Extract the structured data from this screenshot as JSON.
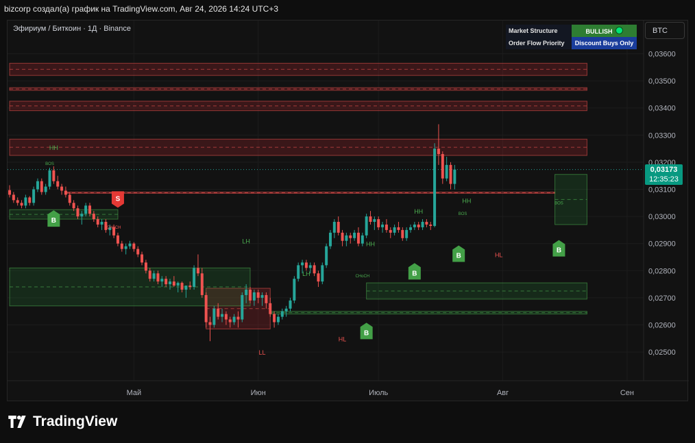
{
  "caption": "bizcorp создал(а) график на TradingView.com, Авг 24, 2026 14:24 UTC+3",
  "symbol_line": "Эфириум / Биткоин · 1Д · Binance",
  "info_table": {
    "market_structure_label": "Market Structure",
    "market_structure_value": "BULLISH",
    "order_flow_label": "Order Flow Priority",
    "order_flow_value": "Discount Buys Only"
  },
  "btc_button": "BTC",
  "last_price": "0,03173",
  "countdown": "12:35:23",
  "brand": "TradingView",
  "colors": {
    "up": "#26a69a",
    "down": "#ef5350",
    "background": "#121212",
    "bullish": "#2e7d32",
    "discount": "#1a3d9c",
    "price_tag": "#089981"
  },
  "chart_data": {
    "type": "candlestick",
    "ylim": [
      0.024,
      0.037
    ],
    "y_ticks": [
      "0,03600",
      "0,03500",
      "0,03400",
      "0,03300",
      "0,03200",
      "0,03100",
      "0,03000",
      "0,02900",
      "0,02800",
      "0,02700",
      "0,02600",
      "0,02500"
    ],
    "x_ticks": [
      "Май",
      "Июн",
      "Июль",
      "Авг",
      "Сен"
    ],
    "x_tick_days": [
      31,
      62,
      92,
      123,
      154
    ],
    "candles": [
      [
        0.03097,
        0.03115,
        0.0307,
        0.0308
      ],
      [
        0.0308,
        0.0309,
        0.0305,
        0.0306
      ],
      [
        0.0306,
        0.0307,
        0.0304,
        0.0305
      ],
      [
        0.0305,
        0.0306,
        0.0303,
        0.0304
      ],
      [
        0.0304,
        0.0308,
        0.0303,
        0.0307
      ],
      [
        0.0307,
        0.03075,
        0.0304,
        0.0305
      ],
      [
        0.0305,
        0.0311,
        0.0304,
        0.031
      ],
      [
        0.031,
        0.0314,
        0.0309,
        0.0313
      ],
      [
        0.0313,
        0.0314,
        0.0308,
        0.0309
      ],
      [
        0.0309,
        0.0312,
        0.0308,
        0.0311
      ],
      [
        0.0311,
        0.0318,
        0.031,
        0.0317
      ],
      [
        0.0317,
        0.03185,
        0.0312,
        0.0313
      ],
      [
        0.0313,
        0.0315,
        0.031,
        0.0311
      ],
      [
        0.0311,
        0.0312,
        0.0308,
        0.03095
      ],
      [
        0.03095,
        0.0311,
        0.0307,
        0.0308
      ],
      [
        0.0308,
        0.0309,
        0.0304,
        0.0305
      ],
      [
        0.0305,
        0.0306,
        0.0302,
        0.0303
      ],
      [
        0.0303,
        0.0304,
        0.0299,
        0.03
      ],
      [
        0.03,
        0.0302,
        0.0297,
        0.0301
      ],
      [
        0.0301,
        0.0305,
        0.03,
        0.0304
      ],
      [
        0.0304,
        0.0305,
        0.03,
        0.0301
      ],
      [
        0.0301,
        0.0302,
        0.0298,
        0.0299
      ],
      [
        0.0299,
        0.03,
        0.0296,
        0.0297
      ],
      [
        0.0297,
        0.0299,
        0.0295,
        0.0298
      ],
      [
        0.0298,
        0.0299,
        0.0294,
        0.0295
      ],
      [
        0.0295,
        0.0297,
        0.0293,
        0.0296
      ],
      [
        0.0296,
        0.0297,
        0.0292,
        0.0293
      ],
      [
        0.0293,
        0.0294,
        0.0289,
        0.029
      ],
      [
        0.029,
        0.0291,
        0.0287,
        0.0288
      ],
      [
        0.0288,
        0.029,
        0.0286,
        0.0289
      ],
      [
        0.0289,
        0.0291,
        0.0288,
        0.029
      ],
      [
        0.029,
        0.02905,
        0.0287,
        0.0288
      ],
      [
        0.0288,
        0.0289,
        0.0285,
        0.0286
      ],
      [
        0.0286,
        0.0287,
        0.0282,
        0.0283
      ],
      [
        0.0283,
        0.0284,
        0.0279,
        0.028
      ],
      [
        0.028,
        0.0281,
        0.0276,
        0.0277
      ],
      [
        0.0277,
        0.028,
        0.0276,
        0.0279
      ],
      [
        0.0279,
        0.028,
        0.0275,
        0.0276
      ],
      [
        0.0276,
        0.0278,
        0.0274,
        0.0277
      ],
      [
        0.0277,
        0.0278,
        0.0274,
        0.0275
      ],
      [
        0.0275,
        0.0277,
        0.0273,
        0.0276
      ],
      [
        0.0276,
        0.0278,
        0.0274,
        0.02745
      ],
      [
        0.02745,
        0.0276,
        0.0272,
        0.02755
      ],
      [
        0.02755,
        0.0276,
        0.0272,
        0.0273
      ],
      [
        0.0273,
        0.0274,
        0.027,
        0.02745
      ],
      [
        0.02745,
        0.0276,
        0.0273,
        0.0274
      ],
      [
        0.0274,
        0.0282,
        0.0273,
        0.0281
      ],
      [
        0.0281,
        0.0286,
        0.0278,
        0.0279
      ],
      [
        0.0279,
        0.0281,
        0.027,
        0.0271
      ],
      [
        0.0271,
        0.0272,
        0.0259,
        0.0261
      ],
      [
        0.0261,
        0.0263,
        0.0254,
        0.026
      ],
      [
        0.026,
        0.0267,
        0.0259,
        0.0266
      ],
      [
        0.0266,
        0.0268,
        0.0262,
        0.0263
      ],
      [
        0.0263,
        0.0266,
        0.0261,
        0.0264
      ],
      [
        0.0264,
        0.0265,
        0.026,
        0.0262
      ],
      [
        0.0262,
        0.0263,
        0.0259,
        0.0261
      ],
      [
        0.0261,
        0.0264,
        0.026,
        0.0263
      ],
      [
        0.0263,
        0.0265,
        0.0259,
        0.0262
      ],
      [
        0.0262,
        0.0272,
        0.0261,
        0.0271
      ],
      [
        0.0271,
        0.0275,
        0.0268,
        0.0273
      ],
      [
        0.0273,
        0.0274,
        0.0268,
        0.0269
      ],
      [
        0.0269,
        0.0273,
        0.0267,
        0.0272
      ],
      [
        0.0272,
        0.0273,
        0.0268,
        0.027
      ],
      [
        0.027,
        0.0272,
        0.0267,
        0.0271
      ],
      [
        0.0271,
        0.0272,
        0.0266,
        0.0268
      ],
      [
        0.0268,
        0.027,
        0.0263,
        0.0264
      ],
      [
        0.0264,
        0.0265,
        0.0259,
        0.0261
      ],
      [
        0.0261,
        0.0264,
        0.026,
        0.0263
      ],
      [
        0.0263,
        0.0266,
        0.0262,
        0.0265
      ],
      [
        0.0265,
        0.0267,
        0.0263,
        0.0266
      ],
      [
        0.0266,
        0.027,
        0.0265,
        0.0269
      ],
      [
        0.0269,
        0.0278,
        0.0268,
        0.0277
      ],
      [
        0.0277,
        0.0283,
        0.0276,
        0.0282
      ],
      [
        0.0282,
        0.0284,
        0.0279,
        0.0283
      ],
      [
        0.0283,
        0.0284,
        0.028,
        0.0281
      ],
      [
        0.0281,
        0.0283,
        0.0279,
        0.0282
      ],
      [
        0.0282,
        0.0283,
        0.0278,
        0.0279
      ],
      [
        0.0279,
        0.028,
        0.0274,
        0.0276
      ],
      [
        0.0276,
        0.0283,
        0.0275,
        0.0282
      ],
      [
        0.0282,
        0.029,
        0.0281,
        0.0289
      ],
      [
        0.0289,
        0.0295,
        0.0288,
        0.0294
      ],
      [
        0.0294,
        0.0299,
        0.0292,
        0.0298
      ],
      [
        0.0298,
        0.03,
        0.0293,
        0.0294
      ],
      [
        0.0294,
        0.0295,
        0.0289,
        0.0291
      ],
      [
        0.0291,
        0.0294,
        0.0289,
        0.0293
      ],
      [
        0.0293,
        0.0294,
        0.029,
        0.0292
      ],
      [
        0.0292,
        0.0295,
        0.0291,
        0.0294
      ],
      [
        0.0294,
        0.0296,
        0.0289,
        0.029
      ],
      [
        0.029,
        0.0294,
        0.0289,
        0.0293
      ],
      [
        0.0293,
        0.0301,
        0.0292,
        0.03
      ],
      [
        0.03,
        0.0302,
        0.0297,
        0.0298
      ],
      [
        0.0298,
        0.03,
        0.0295,
        0.0299
      ],
      [
        0.0299,
        0.03,
        0.0295,
        0.0296
      ],
      [
        0.0296,
        0.0298,
        0.0294,
        0.0297
      ],
      [
        0.0297,
        0.0299,
        0.0294,
        0.0295
      ],
      [
        0.0295,
        0.0296,
        0.0292,
        0.0294
      ],
      [
        0.0294,
        0.0297,
        0.0293,
        0.0296
      ],
      [
        0.0296,
        0.0298,
        0.0294,
        0.0295
      ],
      [
        0.0295,
        0.0296,
        0.0291,
        0.0292
      ],
      [
        0.0292,
        0.0296,
        0.0291,
        0.0295
      ],
      [
        0.0295,
        0.0297,
        0.0294,
        0.0296
      ],
      [
        0.0296,
        0.0298,
        0.0295,
        0.0297
      ],
      [
        0.0297,
        0.0298,
        0.0295,
        0.0296
      ],
      [
        0.0296,
        0.0299,
        0.0295,
        0.0298
      ],
      [
        0.0298,
        0.0299,
        0.0296,
        0.0297
      ],
      [
        0.0297,
        0.0298,
        0.0295,
        0.02965
      ],
      [
        0.02965,
        0.0327,
        0.0296,
        0.0325
      ],
      [
        0.0325,
        0.0334,
        0.0319,
        0.0323
      ],
      [
        0.0323,
        0.0324,
        0.0312,
        0.0314
      ],
      [
        0.0314,
        0.0322,
        0.0313,
        0.0319
      ],
      [
        0.0319,
        0.032,
        0.031,
        0.0312
      ],
      [
        0.0312,
        0.0319,
        0.031,
        0.03173
      ]
    ],
    "zones": [
      {
        "kind": "supply",
        "y1": 0.03565,
        "y2": 0.0352,
        "d1": 0,
        "d2": 144
      },
      {
        "kind": "supply",
        "y1": 0.03475,
        "y2": 0.03465,
        "d1": 0,
        "d2": 144
      },
      {
        "kind": "supply",
        "y1": 0.03425,
        "y2": 0.0339,
        "d1": 0,
        "d2": 144
      },
      {
        "kind": "supply",
        "y1": 0.03285,
        "y2": 0.03225,
        "d1": 0,
        "d2": 144
      },
      {
        "kind": "supply",
        "y1": 0.0309,
        "y2": 0.03085,
        "d1": 14,
        "d2": 136
      },
      {
        "kind": "supply",
        "y1": 0.02735,
        "y2": 0.02585,
        "d1": 49,
        "d2": 65
      },
      {
        "kind": "demand",
        "y1": 0.0281,
        "y2": 0.0267,
        "d1": 0,
        "d2": 60
      },
      {
        "kind": "demand",
        "y1": 0.02755,
        "y2": 0.02695,
        "d1": 89,
        "d2": 144
      },
      {
        "kind": "demand",
        "y1": 0.0265,
        "y2": 0.0264,
        "d1": 65,
        "d2": 144
      },
      {
        "kind": "demand",
        "y1": 0.03155,
        "y2": 0.0297,
        "d1": 136,
        "d2": 144
      },
      {
        "kind": "demand",
        "y1": 0.03025,
        "y2": 0.0299,
        "d1": 0,
        "d2": 27
      }
    ],
    "labels": [
      {
        "text": "HH",
        "d": 11,
        "y": 0.03245,
        "color": "#4caf50"
      },
      {
        "text": "BOS",
        "d": 10,
        "y": 0.0319,
        "color": "#4caf50"
      },
      {
        "text": "CHoCH",
        "d": 26,
        "y": 0.02955,
        "color": "#ef5350"
      },
      {
        "text": "LH",
        "d": 59,
        "y": 0.029,
        "color": "#4caf50"
      },
      {
        "text": "LL",
        "d": 63,
        "y": 0.0249,
        "color": "#ef5350"
      },
      {
        "text": "LH",
        "d": 74,
        "y": 0.0278,
        "color": "#4caf50"
      },
      {
        "text": "HL",
        "d": 83,
        "y": 0.0254,
        "color": "#ef5350"
      },
      {
        "text": "CHoCH",
        "d": 88,
        "y": 0.02775,
        "color": "#4caf50"
      },
      {
        "text": "HH",
        "d": 90,
        "y": 0.0289,
        "color": "#4caf50"
      },
      {
        "text": "HH",
        "d": 102,
        "y": 0.0301,
        "color": "#4caf50"
      },
      {
        "text": "HH",
        "d": 114,
        "y": 0.0305,
        "color": "#4caf50"
      },
      {
        "text": "BOS",
        "d": 113,
        "y": 0.03005,
        "color": "#4caf50"
      },
      {
        "text": "HL",
        "d": 122,
        "y": 0.0285,
        "color": "#ef5350"
      },
      {
        "text": "BOS",
        "d": 137,
        "y": 0.03045,
        "color": "#4caf50"
      }
    ],
    "signals": [
      {
        "type": "S",
        "d": 27,
        "y": 0.0306
      },
      {
        "type": "B",
        "d": 11,
        "y": 0.02995
      },
      {
        "type": "B",
        "d": 89,
        "y": 0.0258
      },
      {
        "type": "B",
        "d": 101,
        "y": 0.028
      },
      {
        "type": "B",
        "d": 112,
        "y": 0.02865
      },
      {
        "type": "B",
        "d": 137,
        "y": 0.02885
      }
    ]
  }
}
